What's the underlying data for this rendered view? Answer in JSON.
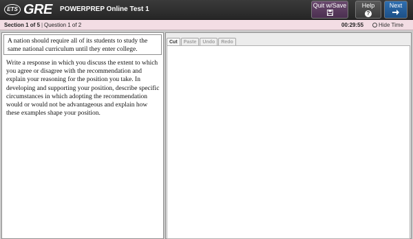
{
  "header": {
    "ets_logo": "ETS",
    "gre_logo": "GRE",
    "test_title": "POWERPREP Online Test 1",
    "quit_label": "Quit w/Save",
    "help_label": "Help",
    "next_label": "Next",
    "colors": {
      "quit": "#5c3d61",
      "help": "#4a4a4a",
      "next": "#2563a0"
    }
  },
  "status": {
    "section": "Section 1 of 5",
    "separator": "|",
    "question": "Question 1 of 2",
    "timer": "00:29:55",
    "hide_time": "Hide Time",
    "bar_color": "#f3dde4"
  },
  "prompt": {
    "statement": "A nation should require all of its students to study the same national curriculum until they enter college.",
    "instructions": "Write a response in which you discuss the extent to which you agree or disagree with the recommendation and explain your reasoning for the position you take. In developing and supporting your position, describe specific circumstances in which adopting the recommendation would or would not be advantageous and explain how these examples shape your position."
  },
  "editor": {
    "toolbar": {
      "cut": "Cut",
      "paste": "Paste",
      "undo": "Undo",
      "redo": "Redo"
    },
    "content": ""
  }
}
